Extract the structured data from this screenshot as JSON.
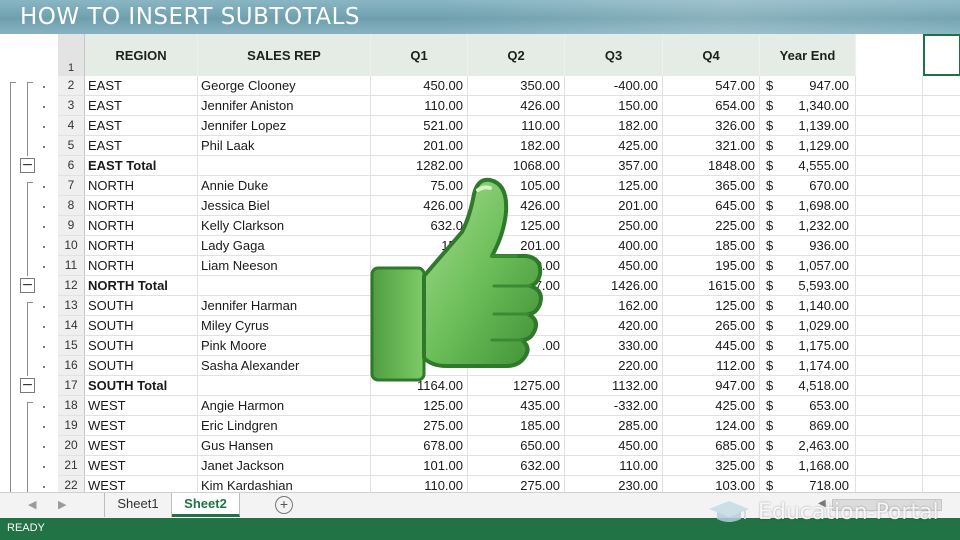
{
  "banner": {
    "title": "HOW TO INSERT SUBTOTALS"
  },
  "columns": {
    "row_header": "1",
    "region": "REGION",
    "sales_rep": "SALES REP",
    "q1": "Q1",
    "q2": "Q2",
    "q3": "Q3",
    "q4": "Q4",
    "year_end": "Year End"
  },
  "rows": [
    {
      "n": "2",
      "region": "EAST",
      "rep": "George Clooney",
      "q1": "450.00",
      "q2": "350.00",
      "q3": "-400.00",
      "q4": "547.00",
      "cur": "$",
      "ye": "947.00",
      "total": false
    },
    {
      "n": "3",
      "region": "EAST",
      "rep": "Jennifer Aniston",
      "q1": "110.00",
      "q2": "426.00",
      "q3": "150.00",
      "q4": "654.00",
      "cur": "$",
      "ye": "1,340.00",
      "total": false
    },
    {
      "n": "4",
      "region": "EAST",
      "rep": "Jennifer Lopez",
      "q1": "521.00",
      "q2": "110.00",
      "q3": "182.00",
      "q4": "326.00",
      "cur": "$",
      "ye": "1,139.00",
      "total": false
    },
    {
      "n": "5",
      "region": "EAST",
      "rep": "Phil Laak",
      "q1": "201.00",
      "q2": "182.00",
      "q3": "425.00",
      "q4": "321.00",
      "cur": "$",
      "ye": "1,129.00",
      "total": false
    },
    {
      "n": "6",
      "region": "EAST Total",
      "rep": "",
      "q1": "1282.00",
      "q2": "1068.00",
      "q3": "357.00",
      "q4": "1848.00",
      "cur": "$",
      "ye": "4,555.00",
      "total": true
    },
    {
      "n": "7",
      "region": "NORTH",
      "rep": "Annie Duke",
      "q1": "75.00",
      "q2": "105.00",
      "q3": "125.00",
      "q4": "365.00",
      "cur": "$",
      "ye": "670.00",
      "total": false
    },
    {
      "n": "8",
      "region": "NORTH",
      "rep": "Jessica Biel",
      "q1": "426.00",
      "q2": "426.00",
      "q3": "201.00",
      "q4": "645.00",
      "cur": "$",
      "ye": "1,698.00",
      "total": false
    },
    {
      "n": "9",
      "region": "NORTH",
      "rep": "Kelly Clarkson",
      "q1": "632.0",
      "q2": "125.00",
      "q3": "250.00",
      "q4": "225.00",
      "cur": "$",
      "ye": "1,232.00",
      "total": false
    },
    {
      "n": "10",
      "region": "NORTH",
      "rep": "Lady Gaga",
      "q1": "150",
      "q2": "201.00",
      "q3": "400.00",
      "q4": "185.00",
      "cur": "$",
      "ye": "936.00",
      "total": false
    },
    {
      "n": "11",
      "region": "NORTH",
      "rep": "Liam Neeson",
      "q1": "1",
      "q2": "0.00",
      "q3": "450.00",
      "q4": "195.00",
      "cur": "$",
      "ye": "1,057.00",
      "total": false
    },
    {
      "n": "12",
      "region": "NORTH Total",
      "rep": "",
      "q1": "",
      "q2": "7.00",
      "q3": "1426.00",
      "q4": "1615.00",
      "cur": "$",
      "ye": "5,593.00",
      "total": true
    },
    {
      "n": "13",
      "region": "SOUTH",
      "rep": "Jennifer Harman",
      "q1": "",
      "q2": "",
      "q3": "162.00",
      "q4": "125.00",
      "cur": "$",
      "ye": "1,140.00",
      "total": false
    },
    {
      "n": "14",
      "region": "SOUTH",
      "rep": "Miley Cyrus",
      "q1": "",
      "q2": "",
      "q3": "420.00",
      "q4": "265.00",
      "cur": "$",
      "ye": "1,029.00",
      "total": false
    },
    {
      "n": "15",
      "region": "SOUTH",
      "rep": "Pink Moore",
      "q1": "",
      "q2": ".00",
      "q3": "330.00",
      "q4": "445.00",
      "cur": "$",
      "ye": "1,175.00",
      "total": false
    },
    {
      "n": "16",
      "region": "SOUTH",
      "rep": "Sasha Alexander",
      "q1": "",
      "q2": "",
      "q3": "220.00",
      "q4": "112.00",
      "cur": "$",
      "ye": "1,174.00",
      "total": false
    },
    {
      "n": "17",
      "region": "SOUTH Total",
      "rep": "",
      "q1": "1164.00",
      "q2": "1275.00",
      "q3": "1132.00",
      "q4": "947.00",
      "cur": "$",
      "ye": "4,518.00",
      "total": true
    },
    {
      "n": "18",
      "region": "WEST",
      "rep": "Angie Harmon",
      "q1": "125.00",
      "q2": "435.00",
      "q3": "-332.00",
      "q4": "425.00",
      "cur": "$",
      "ye": "653.00",
      "total": false
    },
    {
      "n": "19",
      "region": "WEST",
      "rep": "Eric Lindgren",
      "q1": "275.00",
      "q2": "185.00",
      "q3": "285.00",
      "q4": "124.00",
      "cur": "$",
      "ye": "869.00",
      "total": false
    },
    {
      "n": "20",
      "region": "WEST",
      "rep": "Gus Hansen",
      "q1": "678.00",
      "q2": "650.00",
      "q3": "450.00",
      "q4": "685.00",
      "cur": "$",
      "ye": "2,463.00",
      "total": false
    },
    {
      "n": "21",
      "region": "WEST",
      "rep": "Janet  Jackson",
      "q1": "101.00",
      "q2": "632.00",
      "q3": "110.00",
      "q4": "325.00",
      "cur": "$",
      "ye": "1,168.00",
      "total": false
    },
    {
      "n": "22",
      "region": "WEST",
      "rep": "Kim Kardashian",
      "q1": "110.00",
      "q2": "275.00",
      "q3": "230.00",
      "q4": "103.00",
      "cur": "$",
      "ye": "718.00",
      "total": false
    }
  ],
  "outline": {
    "collapse_symbol": "−"
  },
  "sheet_tabs": [
    {
      "label": "Sheet1",
      "active": false
    },
    {
      "label": "Sheet2",
      "active": true
    }
  ],
  "tabbar": {
    "add_sheet_symbol": "+"
  },
  "status": {
    "text": "READY"
  },
  "watermark": {
    "text": "Education-Portal",
    "icon": "graduation-cap-icon"
  },
  "overlay": {
    "icon": "thumbs-up-icon"
  },
  "colors": {
    "accent": "#217346",
    "header_bg": "#e5ece6",
    "banner": "#7aa8b7",
    "thumb": "#6cbf5a"
  }
}
